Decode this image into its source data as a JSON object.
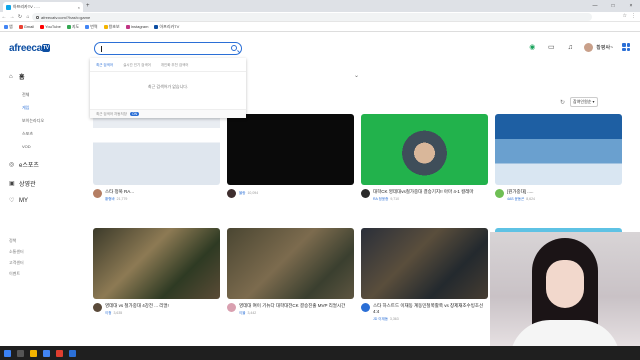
{
  "browser": {
    "tab_title": "아프리카TV - ...",
    "close_symbol": "×",
    "new_tab_symbol": "+",
    "url": "afreecatv.com/?hash=game",
    "nav": {
      "back": "←",
      "forward": "→",
      "reload": "↻",
      "home": "⌂"
    },
    "bookmarks": [
      {
        "label": "앱",
        "color": "#4285f4"
      },
      {
        "label": "Gmail",
        "color": "#ea4335"
      },
      {
        "label": "YouTube",
        "color": "#ff0000"
      },
      {
        "label": "지도",
        "color": "#34a853"
      },
      {
        "label": "번역",
        "color": "#4285f4"
      },
      {
        "label": "왕초보",
        "color": "#f4b400"
      },
      {
        "label": "Instagram",
        "color": "#c13584"
      },
      {
        "label": "아프리카TV",
        "color": "#0c4ea2"
      }
    ],
    "extras": {
      "star": "☆",
      "menu": "⋮"
    },
    "window": {
      "min": "—",
      "max": "□",
      "close": "×"
    }
  },
  "header": {
    "logo_text": "afreeca",
    "logo_tv": "TV",
    "search_placeholder": "",
    "user_name": "황평싸~",
    "icons": [
      "cash-icon",
      "video-icon",
      "bell-icon",
      "apps-icon"
    ]
  },
  "search_dropdown": {
    "tabs": [
      "최근 검색어",
      "실시간 인기 검색어",
      "개인화 추천 검색어"
    ],
    "empty_text": "최근 검색어가 없습니다.",
    "auto_save_label": "최근 검색어 자동저장",
    "auto_save_state": "ON"
  },
  "sidebar": {
    "home": "홈",
    "home_icon": "⌂",
    "sub_items": [
      "전체",
      "게임",
      "보이는라디오",
      "스포츠",
      "VOD"
    ],
    "active_sub": "게임",
    "esports": "e스포츠",
    "esports_icon": "◎",
    "studio": "상영관",
    "studio_icon": "▣",
    "my": "MY",
    "my_icon": "♡",
    "footer": [
      "정책",
      "소통센터",
      "고객센터",
      "이벤트"
    ]
  },
  "sort": {
    "refresh_icon": "↻",
    "label": "참여인원순 ▾"
  },
  "collapse_icon": "⌄",
  "cards": [
    {
      "title": "스타 정복 RA...",
      "streamer": "황형바",
      "count": "21,779",
      "avatar": "#b47e63",
      "thumb": "t1"
    },
    {
      "title": "",
      "streamer": "블랑",
      "count": "10,094",
      "avatar": "#3e2e2e",
      "thumb": "t2"
    },
    {
      "title": "대학CK 영데대vs철가중대 결승기지!! 아마 4-1 컬레마",
      "streamer": "RA 정윤종",
      "count": "9,710",
      "avatar": "#2b2b2b",
      "thumb": "t3"
    },
    {
      "title": "[뭔가중대] .....",
      "streamer": "4AS 윤동곤",
      "count": "8,624",
      "avatar": "#6fbf55",
      "thumb": "t4"
    },
    {
      "title": "영데대 vs 철가중대 4강전 ... 리얼!",
      "streamer": "이청",
      "count": "3,635",
      "avatar": "#5a4a3a",
      "thumb": "t5"
    },
    {
      "title": "영데대 여이 기뉴다 대학대전CK 결승진출 MVP 리얼시간",
      "streamer": "이블",
      "count": "3,442",
      "avatar": "#d9a0b0",
      "thumb": "t6"
    },
    {
      "title": "스타 하스트드 이재동 계동민철쭉활쭉 vs 창제재조수빙초선 4:4",
      "streamer": "JD 이재동",
      "count": "3,363",
      "avatar": "#2b6fd6",
      "thumb": "t7"
    },
    {
      "title": "",
      "streamer": "",
      "count": "",
      "avatar": "#ffffff",
      "thumb": "t8"
    }
  ]
}
